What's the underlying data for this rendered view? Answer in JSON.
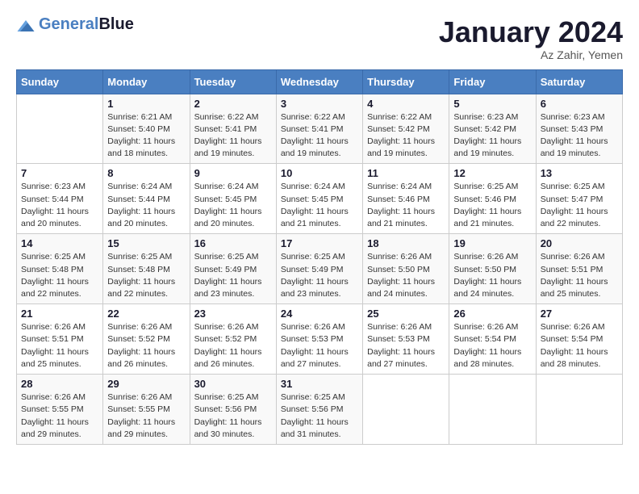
{
  "header": {
    "logo_line1": "General",
    "logo_line2": "Blue",
    "month": "January 2024",
    "location": "Az Zahir, Yemen"
  },
  "days_of_week": [
    "Sunday",
    "Monday",
    "Tuesday",
    "Wednesday",
    "Thursday",
    "Friday",
    "Saturday"
  ],
  "weeks": [
    [
      {
        "day": "",
        "info": ""
      },
      {
        "day": "1",
        "info": "Sunrise: 6:21 AM\nSunset: 5:40 PM\nDaylight: 11 hours\nand 18 minutes."
      },
      {
        "day": "2",
        "info": "Sunrise: 6:22 AM\nSunset: 5:41 PM\nDaylight: 11 hours\nand 19 minutes."
      },
      {
        "day": "3",
        "info": "Sunrise: 6:22 AM\nSunset: 5:41 PM\nDaylight: 11 hours\nand 19 minutes."
      },
      {
        "day": "4",
        "info": "Sunrise: 6:22 AM\nSunset: 5:42 PM\nDaylight: 11 hours\nand 19 minutes."
      },
      {
        "day": "5",
        "info": "Sunrise: 6:23 AM\nSunset: 5:42 PM\nDaylight: 11 hours\nand 19 minutes."
      },
      {
        "day": "6",
        "info": "Sunrise: 6:23 AM\nSunset: 5:43 PM\nDaylight: 11 hours\nand 19 minutes."
      }
    ],
    [
      {
        "day": "7",
        "info": "Sunrise: 6:23 AM\nSunset: 5:44 PM\nDaylight: 11 hours\nand 20 minutes."
      },
      {
        "day": "8",
        "info": "Sunrise: 6:24 AM\nSunset: 5:44 PM\nDaylight: 11 hours\nand 20 minutes."
      },
      {
        "day": "9",
        "info": "Sunrise: 6:24 AM\nSunset: 5:45 PM\nDaylight: 11 hours\nand 20 minutes."
      },
      {
        "day": "10",
        "info": "Sunrise: 6:24 AM\nSunset: 5:45 PM\nDaylight: 11 hours\nand 21 minutes."
      },
      {
        "day": "11",
        "info": "Sunrise: 6:24 AM\nSunset: 5:46 PM\nDaylight: 11 hours\nand 21 minutes."
      },
      {
        "day": "12",
        "info": "Sunrise: 6:25 AM\nSunset: 5:46 PM\nDaylight: 11 hours\nand 21 minutes."
      },
      {
        "day": "13",
        "info": "Sunrise: 6:25 AM\nSunset: 5:47 PM\nDaylight: 11 hours\nand 22 minutes."
      }
    ],
    [
      {
        "day": "14",
        "info": "Sunrise: 6:25 AM\nSunset: 5:48 PM\nDaylight: 11 hours\nand 22 minutes."
      },
      {
        "day": "15",
        "info": "Sunrise: 6:25 AM\nSunset: 5:48 PM\nDaylight: 11 hours\nand 22 minutes."
      },
      {
        "day": "16",
        "info": "Sunrise: 6:25 AM\nSunset: 5:49 PM\nDaylight: 11 hours\nand 23 minutes."
      },
      {
        "day": "17",
        "info": "Sunrise: 6:25 AM\nSunset: 5:49 PM\nDaylight: 11 hours\nand 23 minutes."
      },
      {
        "day": "18",
        "info": "Sunrise: 6:26 AM\nSunset: 5:50 PM\nDaylight: 11 hours\nand 24 minutes."
      },
      {
        "day": "19",
        "info": "Sunrise: 6:26 AM\nSunset: 5:50 PM\nDaylight: 11 hours\nand 24 minutes."
      },
      {
        "day": "20",
        "info": "Sunrise: 6:26 AM\nSunset: 5:51 PM\nDaylight: 11 hours\nand 25 minutes."
      }
    ],
    [
      {
        "day": "21",
        "info": "Sunrise: 6:26 AM\nSunset: 5:51 PM\nDaylight: 11 hours\nand 25 minutes."
      },
      {
        "day": "22",
        "info": "Sunrise: 6:26 AM\nSunset: 5:52 PM\nDaylight: 11 hours\nand 26 minutes."
      },
      {
        "day": "23",
        "info": "Sunrise: 6:26 AM\nSunset: 5:52 PM\nDaylight: 11 hours\nand 26 minutes."
      },
      {
        "day": "24",
        "info": "Sunrise: 6:26 AM\nSunset: 5:53 PM\nDaylight: 11 hours\nand 27 minutes."
      },
      {
        "day": "25",
        "info": "Sunrise: 6:26 AM\nSunset: 5:53 PM\nDaylight: 11 hours\nand 27 minutes."
      },
      {
        "day": "26",
        "info": "Sunrise: 6:26 AM\nSunset: 5:54 PM\nDaylight: 11 hours\nand 28 minutes."
      },
      {
        "day": "27",
        "info": "Sunrise: 6:26 AM\nSunset: 5:54 PM\nDaylight: 11 hours\nand 28 minutes."
      }
    ],
    [
      {
        "day": "28",
        "info": "Sunrise: 6:26 AM\nSunset: 5:55 PM\nDaylight: 11 hours\nand 29 minutes."
      },
      {
        "day": "29",
        "info": "Sunrise: 6:26 AM\nSunset: 5:55 PM\nDaylight: 11 hours\nand 29 minutes."
      },
      {
        "day": "30",
        "info": "Sunrise: 6:25 AM\nSunset: 5:56 PM\nDaylight: 11 hours\nand 30 minutes."
      },
      {
        "day": "31",
        "info": "Sunrise: 6:25 AM\nSunset: 5:56 PM\nDaylight: 11 hours\nand 31 minutes."
      },
      {
        "day": "",
        "info": ""
      },
      {
        "day": "",
        "info": ""
      },
      {
        "day": "",
        "info": ""
      }
    ]
  ]
}
